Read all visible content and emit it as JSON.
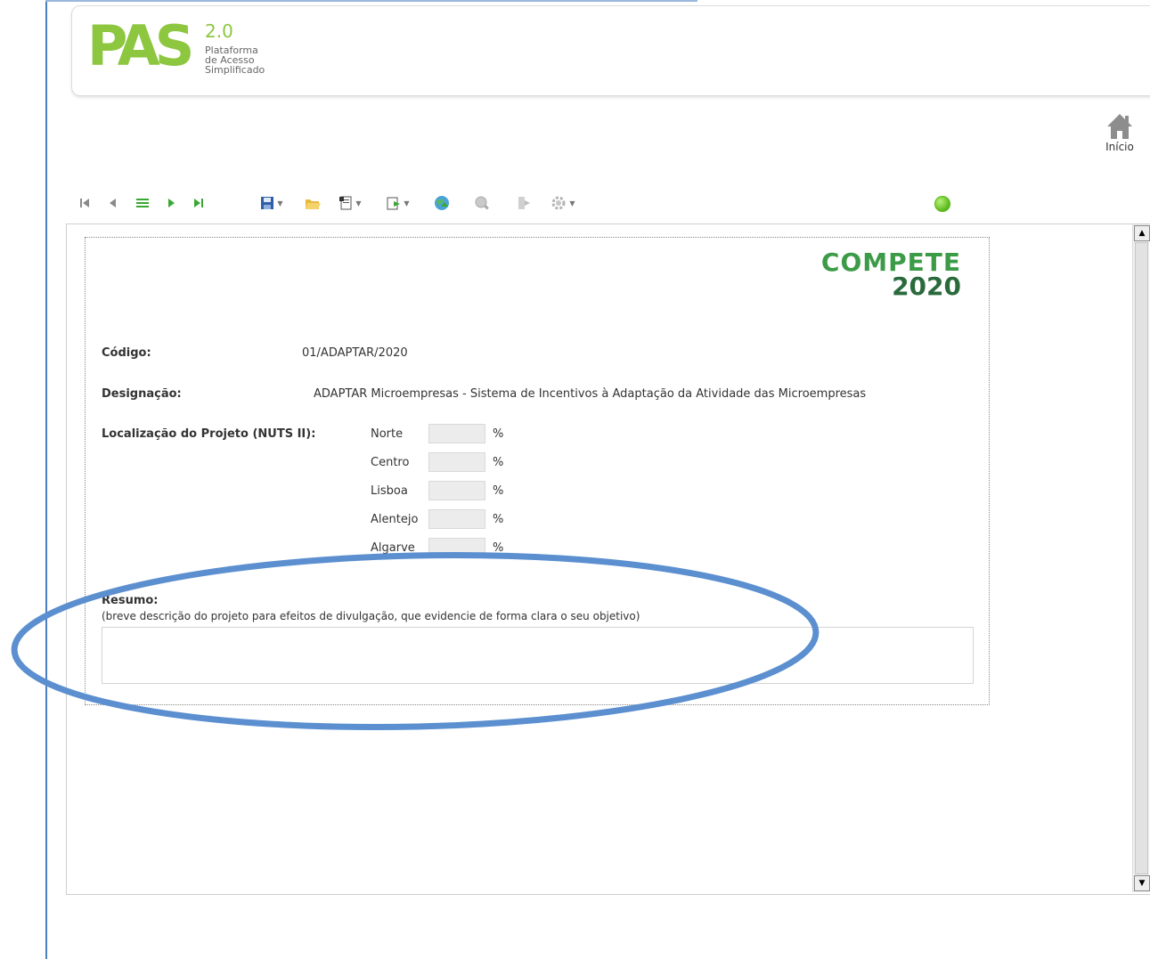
{
  "header": {
    "logo_text": "PAS",
    "version": "2.0",
    "subtitle_lines": [
      "Plataforma",
      "de Acesso",
      "Simplificado"
    ]
  },
  "home": {
    "label": "Início",
    "icon": "home-icon"
  },
  "toolbar": {
    "icons": [
      "first-record-icon",
      "previous-record-icon",
      "list-icon",
      "next-record-icon",
      "last-record-icon",
      "save-icon",
      "open-folder-icon",
      "new-document-icon",
      "export-icon",
      "globe-upload-icon",
      "search-icon",
      "exit-icon",
      "settings-icon"
    ],
    "status_color": "#5fbd20"
  },
  "form": {
    "brand": {
      "word": "COMPETE",
      "year": "2020"
    },
    "codigo": {
      "label": "Código:",
      "value": "01/ADAPTAR/2020"
    },
    "designacao": {
      "label": "Designação:",
      "value": "ADAPTAR Microempresas - Sistema de Incentivos à Adaptação da Atividade das Microempresas"
    },
    "localizacao": {
      "label": "Localização do Projeto (NUTS II):",
      "unit": "%",
      "regions": [
        "Norte",
        "Centro",
        "Lisboa",
        "Alentejo",
        "Algarve"
      ]
    },
    "resumo": {
      "label": "Resumo:",
      "hint": "(breve descrição do projeto para efeitos de divulgação, que evidencie de forma clara o seu objetivo)",
      "value": ""
    }
  },
  "annotation": {
    "color": "#5b8fcf"
  }
}
